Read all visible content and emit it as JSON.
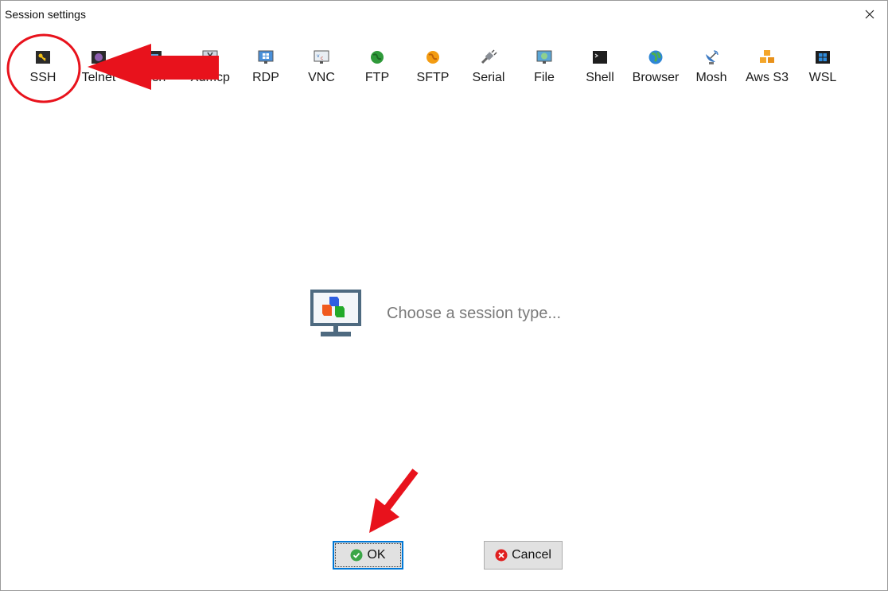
{
  "window": {
    "title": "Session settings"
  },
  "session_types": [
    {
      "label": "SSH",
      "icon": "ssh-key-icon"
    },
    {
      "label": "Telnet",
      "icon": "telnet-icon"
    },
    {
      "label": "Rsh",
      "icon": "rsh-icon"
    },
    {
      "label": "Xdmcp",
      "icon": "xdmcp-icon"
    },
    {
      "label": "RDP",
      "icon": "rdp-icon"
    },
    {
      "label": "VNC",
      "icon": "vnc-icon"
    },
    {
      "label": "FTP",
      "icon": "ftp-globe-icon"
    },
    {
      "label": "SFTP",
      "icon": "sftp-globe-icon"
    },
    {
      "label": "Serial",
      "icon": "serial-plug-icon"
    },
    {
      "label": "File",
      "icon": "file-icon"
    },
    {
      "label": "Shell",
      "icon": "shell-terminal-icon"
    },
    {
      "label": "Browser",
      "icon": "browser-globe-icon"
    },
    {
      "label": "Mosh",
      "icon": "mosh-satellite-icon"
    },
    {
      "label": "Aws S3",
      "icon": "aws-s3-icon"
    },
    {
      "label": "WSL",
      "icon": "wsl-windows-icon"
    }
  ],
  "main": {
    "message": "Choose a session type..."
  },
  "buttons": {
    "ok": "OK",
    "cancel": "Cancel"
  },
  "colors": {
    "annotation_red": "#e8121c",
    "focus_blue": "#0078d7"
  }
}
